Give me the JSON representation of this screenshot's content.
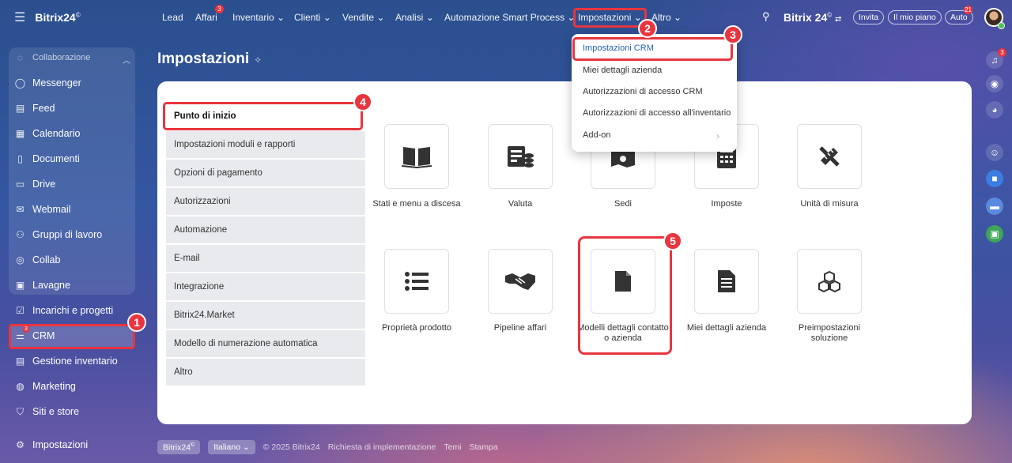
{
  "app": {
    "logo": "Bitrix24",
    "logo_mark": "©"
  },
  "sidebar": {
    "section_header": "Collaborazione",
    "items": [
      {
        "label": "Messenger",
        "icon": "messenger-icon"
      },
      {
        "label": "Feed",
        "icon": "feed-icon"
      },
      {
        "label": "Calendario",
        "icon": "calendar-icon"
      },
      {
        "label": "Documenti",
        "icon": "document-icon"
      },
      {
        "label": "Drive",
        "icon": "drive-icon"
      },
      {
        "label": "Webmail",
        "icon": "mail-icon"
      },
      {
        "label": "Gruppi di lavoro",
        "icon": "group-icon"
      },
      {
        "label": "Collab",
        "icon": "collab-icon"
      },
      {
        "label": "Lavagne",
        "icon": "board-icon"
      },
      {
        "label": "Incarichi e progetti",
        "icon": "task-icon"
      },
      {
        "label": "CRM",
        "icon": "crm-icon",
        "badge": "3"
      },
      {
        "label": "Gestione inventario",
        "icon": "inventory-icon"
      },
      {
        "label": "Marketing",
        "icon": "marketing-icon"
      },
      {
        "label": "Siti e store",
        "icon": "cart-icon"
      },
      {
        "label": "Impostazioni",
        "icon": "settings-icon"
      }
    ]
  },
  "topnav": {
    "items": [
      "Lead",
      "Affari",
      "Inventario",
      "Clienti",
      "Vendite",
      "Analisi",
      "Automazione Smart Process",
      "Impostazioni",
      "Altro"
    ],
    "affari_badge": "3",
    "brand": "Bitrix 24",
    "invite": "Invita",
    "plan": "Il mio piano",
    "auto": "Auto",
    "auto_badge": "21"
  },
  "rail": {
    "notif_badge": "3"
  },
  "page": {
    "title": "Impostazioni"
  },
  "settings_menu": [
    "Punto di inizio",
    "Impostazioni moduli e rapporti",
    "Opzioni di pagamento",
    "Autorizzazioni",
    "Automazione",
    "E-mail",
    "Integrazione",
    "Bitrix24.Market",
    "Modello di numerazione automatica",
    "Altro"
  ],
  "tiles": [
    {
      "label": "Stati e menu a discesa",
      "icon": "book-icon"
    },
    {
      "label": "Valuta",
      "icon": "currency-icon"
    },
    {
      "label": "Sedi",
      "icon": "map-pin-icon"
    },
    {
      "label": "Imposte",
      "icon": "calculator-icon"
    },
    {
      "label": "Unità di misura",
      "icon": "ruler-icon"
    },
    {
      "label": "Proprietà prodotto",
      "icon": "list-icon"
    },
    {
      "label": "Pipeline affari",
      "icon": "handshake-icon"
    },
    {
      "label": "Modelli dettagli contatto o azienda",
      "icon": "file-icon"
    },
    {
      "label": "Miei dettagli azienda",
      "icon": "doc-text-icon"
    },
    {
      "label": "Preimpostazioni soluzione",
      "icon": "cubes-icon"
    }
  ],
  "dropdown": {
    "items": [
      "Impostazioni CRM",
      "Miei dettagli azienda",
      "Autorizzazioni di accesso CRM",
      "Autorizzazioni di accesso all'inventario",
      "Add-on"
    ]
  },
  "callouts": [
    "1",
    "2",
    "3",
    "4",
    "5"
  ],
  "footer": {
    "brand_btn": "Bitrix24",
    "lang_btn": "Italiano",
    "copyright": "© 2025 Bitrix24",
    "links": [
      "Richiesta di implementazione",
      "Temi",
      "Stampa"
    ]
  },
  "colors": {
    "highlight": "#e8353f",
    "link": "#2067b0",
    "badge": "#e8353f"
  }
}
